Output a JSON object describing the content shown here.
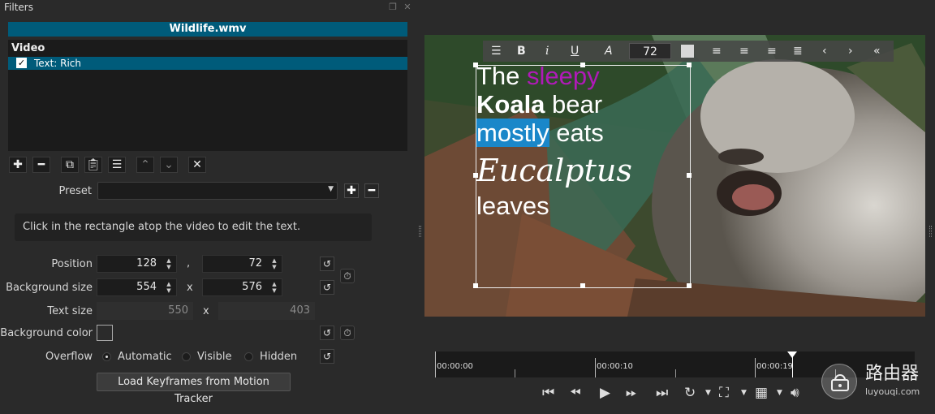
{
  "panel": {
    "title": "Filters"
  },
  "clip": {
    "name": "Wildlife.wmv"
  },
  "filter_list": {
    "header": "Video",
    "items": [
      {
        "label": "Text: Rich",
        "checked": true
      }
    ]
  },
  "toolbar_icons": [
    "add-icon",
    "remove-icon",
    "copy-icon",
    "paste-icon",
    "stack-icon",
    "move-up-icon",
    "move-down-icon",
    "deselect-icon"
  ],
  "preset": {
    "label": "Preset",
    "value": ""
  },
  "info_text": "Click in the rectangle atop the video to edit the text.",
  "position": {
    "label": "Position",
    "x": "128",
    "sep": ",",
    "y": "72"
  },
  "background_size": {
    "label": "Background size",
    "w": "554",
    "sep": "x",
    "h": "576"
  },
  "text_size": {
    "label": "Text size",
    "w": "550",
    "sep": "x",
    "h": "403"
  },
  "background_color": {
    "label": "Background color",
    "value": "#2b2b2b"
  },
  "overflow": {
    "label": "Overflow",
    "options": [
      "Automatic",
      "Visible",
      "Hidden"
    ],
    "selected": "Automatic"
  },
  "load_button": "Load Keyframes from Motion Tracker",
  "rich_toolbar": {
    "font_size": "72"
  },
  "overlay_text": {
    "w1": "The",
    "w2": "sleepy",
    "w3": "Koala",
    "w4": "bear",
    "w5": "mostly",
    "w6": "eats",
    "w7": "Eucalptus",
    "w8": "leaves"
  },
  "timeline": {
    "t0": "00:00:00",
    "t1": "00:00:10",
    "t2": "00:00:19",
    "playhead_fraction": 0.745
  },
  "watermark": {
    "title": "路由器",
    "url": "luyouqi.com"
  },
  "colors": {
    "accent": "#005b7a",
    "sleepy": "#b01ab8",
    "highlight": "#1a87c9"
  }
}
